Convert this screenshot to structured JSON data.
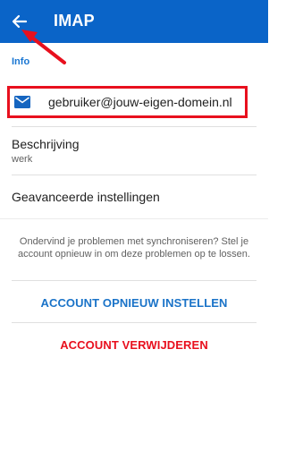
{
  "appbar": {
    "title": "IMAP",
    "back_icon": "arrow-left-icon",
    "bg_color": "#0a64c8"
  },
  "info": {
    "header": "Info",
    "email_icon": "mail-icon",
    "email": "gebruiker@jouw-eigen-domein.nl",
    "description_label": "Beschrijving",
    "description_value": "werk",
    "advanced_label": "Geavanceerde instellingen"
  },
  "sync_help": {
    "text": "Ondervind je problemen met synchroniseren? Stel je account opnieuw in om deze problemen op te lossen."
  },
  "actions": {
    "reset_label": "ACCOUNT OPNIEUW INSTELLEN",
    "delete_label": "ACCOUNT VERWIJDEREN"
  },
  "colors": {
    "accent": "#1a73c8",
    "danger": "#e8101e",
    "highlight": "#e8101e"
  }
}
